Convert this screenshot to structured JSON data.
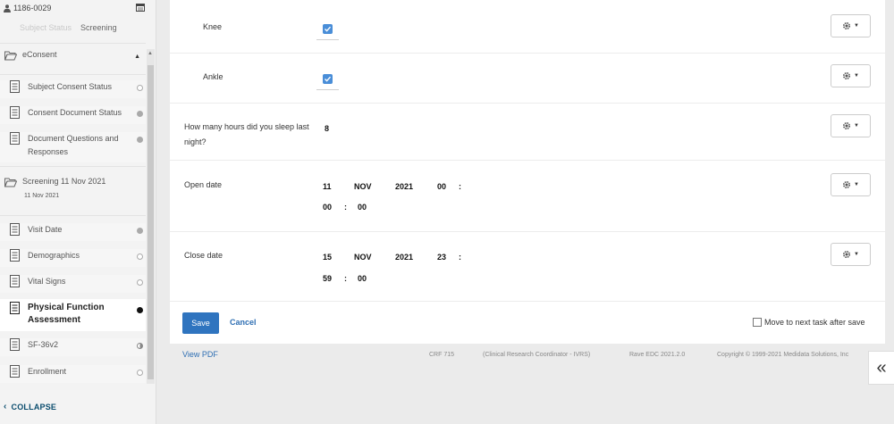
{
  "subject": {
    "id": "1186-0029",
    "person_icon": "person-icon",
    "calendar_icon": "calendar-icon"
  },
  "status_tabs": [
    "Subject Status",
    "Screening"
  ],
  "sidebar": {
    "folders": [
      {
        "label": "eConsent",
        "sub": ""
      },
      {
        "label": "Screening 11 Nov 2021",
        "sub": "11 Nov 2021"
      }
    ],
    "items": [
      {
        "label": "Subject Consent Status",
        "status": "empty"
      },
      {
        "label": "Consent Document Status",
        "status": "grey"
      },
      {
        "label": "Document Questions and Responses",
        "status": "grey"
      },
      {
        "label": "Visit Date",
        "status": "grey"
      },
      {
        "label": "Demographics",
        "status": "empty"
      },
      {
        "label": "Vital Signs",
        "status": "empty"
      },
      {
        "label": "Physical Function Assessment",
        "status": "black"
      },
      {
        "label": "SF-36v2",
        "status": "half"
      },
      {
        "label": "Enrollment",
        "status": "empty"
      }
    ],
    "collapse_label": "COLLAPSE"
  },
  "form": {
    "knee": {
      "label": "Knee",
      "checked": true
    },
    "ankle": {
      "label": "Ankle",
      "checked": true
    },
    "sleep": {
      "label": "How many hours did you sleep last night?",
      "value": "8"
    },
    "open_date": {
      "label": "Open date",
      "day": "11",
      "month": "NOV",
      "year": "2021",
      "hour": "00",
      "minute": "00",
      "second": "00"
    },
    "close_date": {
      "label": "Close date",
      "day": "15",
      "month": "NOV",
      "year": "2021",
      "hour": "23",
      "minute": "59",
      "second": "00"
    },
    "save_label": "Save",
    "cancel_label": "Cancel",
    "move_next_label": "Move to next task after save"
  },
  "footer": {
    "view_pdf": "View PDF",
    "crf": "CRF 715",
    "role": "(Clinical Research Coordinator - IVRS)",
    "version": "Rave EDC 2021.2.0",
    "copyright": "Copyright © 1999-2021 Medidata Solutions, Inc"
  },
  "expand_glyph": "«",
  "colors": {
    "accent": "#2f74bf",
    "checkbox": "#4a8ed8",
    "collapse_text": "#0b4d6e"
  }
}
